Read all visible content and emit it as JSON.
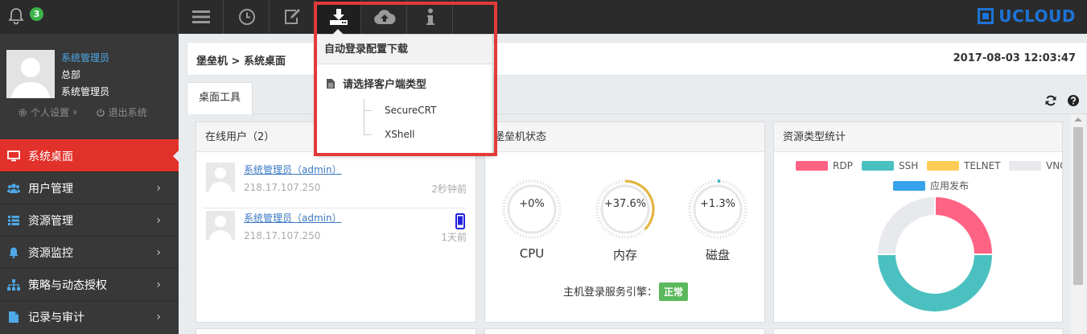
{
  "topbar": {
    "notification_count": "3",
    "brand": "UCLOUD",
    "brand_color": "#1d74d8",
    "buttons": [
      {
        "icon": "menu-icon"
      },
      {
        "icon": "clock-icon"
      },
      {
        "icon": "edit-icon"
      },
      {
        "icon": "download-icon"
      },
      {
        "icon": "cloud-upload-icon"
      },
      {
        "icon": "info-icon"
      }
    ]
  },
  "user": {
    "name": "系统管理员",
    "org": "总部",
    "role": "系统管理员",
    "settings_label": "个人设置",
    "logout_label": "退出系统"
  },
  "sidebar": {
    "items": [
      {
        "label": "系统桌面",
        "icon": "desktop-icon",
        "active": true
      },
      {
        "label": "用户管理",
        "icon": "users-icon"
      },
      {
        "label": "资源管理",
        "icon": "list-icon"
      },
      {
        "label": "资源监控",
        "icon": "bell-icon"
      },
      {
        "label": "策略与动态授权",
        "icon": "sitemap-icon"
      },
      {
        "label": "记录与审计",
        "icon": "file-icon"
      }
    ],
    "active_color": "#e2312a"
  },
  "header": {
    "breadcrumb": "堡垒机 > 系统桌面",
    "datetime": "2017-08-03 12:03:47"
  },
  "tabs": [
    {
      "label": "桌面工具"
    }
  ],
  "online_users": {
    "title": "在线用户（2）",
    "rows": [
      {
        "name": "系统管理员（admin）",
        "ip": "218.17.107.250",
        "time": "2秒钟前",
        "device": ""
      },
      {
        "name": "系统管理员（admin）",
        "ip": "218.17.107.250",
        "time": "1天前",
        "device": "mobile-icon"
      }
    ]
  },
  "status": {
    "title": "堡垒机状态",
    "gauges": [
      {
        "value": "+0%",
        "label": "CPU",
        "fraction": 0.0
      },
      {
        "value": "+37.6%",
        "label": "内存",
        "fraction": 0.376
      },
      {
        "value": "+1.3%",
        "label": "磁盘",
        "fraction": 0.013
      }
    ],
    "service_label": "主机登录服务引擎：",
    "service_status": "正常"
  },
  "resource_types": {
    "title": "资源类型统计",
    "legend": [
      {
        "name": "RDP",
        "color": "#ff6384"
      },
      {
        "name": "SSH",
        "color": "#4bc0c0"
      },
      {
        "name": "TELNET",
        "color": "#ffcd56"
      },
      {
        "name": "VNC",
        "color": "#e7e9ed"
      },
      {
        "name": "应用发布",
        "color": "#36a2eb"
      }
    ],
    "slices": [
      {
        "name": "RDP",
        "value": 25,
        "color": "#ff6384"
      },
      {
        "name": "SSH",
        "value": 50,
        "color": "#4bc0c0"
      },
      {
        "name": "VNC",
        "value": 25,
        "color": "#e7e9ed"
      }
    ]
  },
  "dropdown": {
    "title": "自动登录配置下载",
    "caption": "请选择客户端类型",
    "options": [
      "SecureCRT",
      "XShell"
    ]
  }
}
